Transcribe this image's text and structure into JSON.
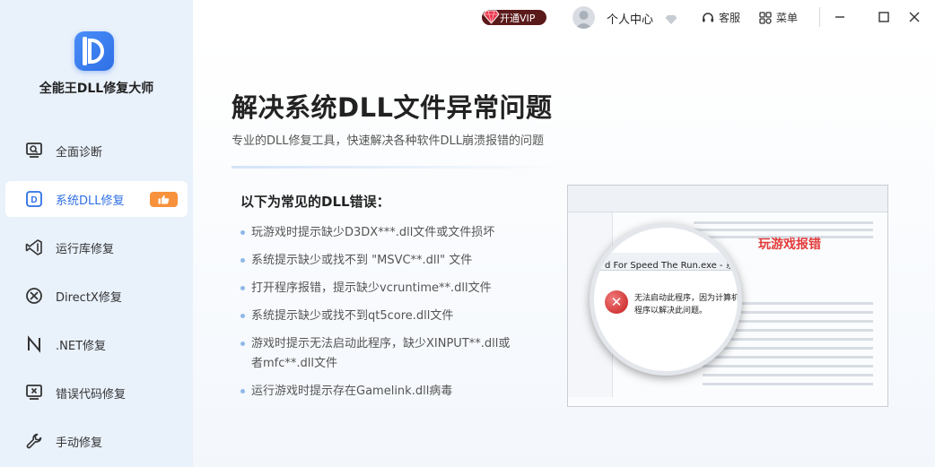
{
  "app": {
    "title": "全能王DLL修复大师"
  },
  "sidebar": {
    "items": [
      {
        "label": "全面诊断",
        "icon": "monitor-search-icon",
        "active": false
      },
      {
        "label": "系统DLL修复",
        "icon": "dll-d-icon",
        "active": true,
        "badge": "thumbs-up-icon"
      },
      {
        "label": "运行库修复",
        "icon": "visual-studio-icon",
        "active": false
      },
      {
        "label": "DirectX修复",
        "icon": "xbox-icon",
        "active": false
      },
      {
        "label": ".NET修复",
        "icon": "dotnet-n-icon",
        "active": false
      },
      {
        "label": "错误代码修复",
        "icon": "monitor-error-icon",
        "active": false
      },
      {
        "label": "手动修复",
        "icon": "wrench-icon",
        "active": false
      }
    ]
  },
  "topbar": {
    "vip_label": "开通VIP",
    "user_center_label": "个人中心",
    "service_label": "客服",
    "menu_label": "菜单"
  },
  "main": {
    "headline": "解决系统DLL文件异常问题",
    "subline": "专业的DLL修复工具，快速解决各种软件DLL崩溃报错的问题",
    "errors_title": "以下为常见的DLL错误：",
    "errors": [
      "玩游戏时提示缺少D3DX***.dll文件或文件损坏",
      "系统提示缺少或找不到 \"MSVC**.dll\" 文件",
      "打开程序报错，提示缺少vcruntime**.dll文件",
      "系统提示缺少或找不到qt5core.dll文件",
      "游戏时提示无法启动此程序，缺少XINPUT**.dll或者mfc**.dll文件",
      "运行游戏时提示存在Gamelink.dll病毒"
    ],
    "example": {
      "label": "玩游戏报错",
      "dialog_title": "d For Speed The Run.exe - 系统错误",
      "message_line1": "无法启动此程序，因为计算机中",
      "message_line2": "程序以解决此问题。"
    }
  },
  "colors": {
    "accent": "#2f6fe6",
    "sidebar_bg": "#e9f1fb",
    "badge_orange": "#f7913b",
    "error_red": "#e23a3a"
  }
}
